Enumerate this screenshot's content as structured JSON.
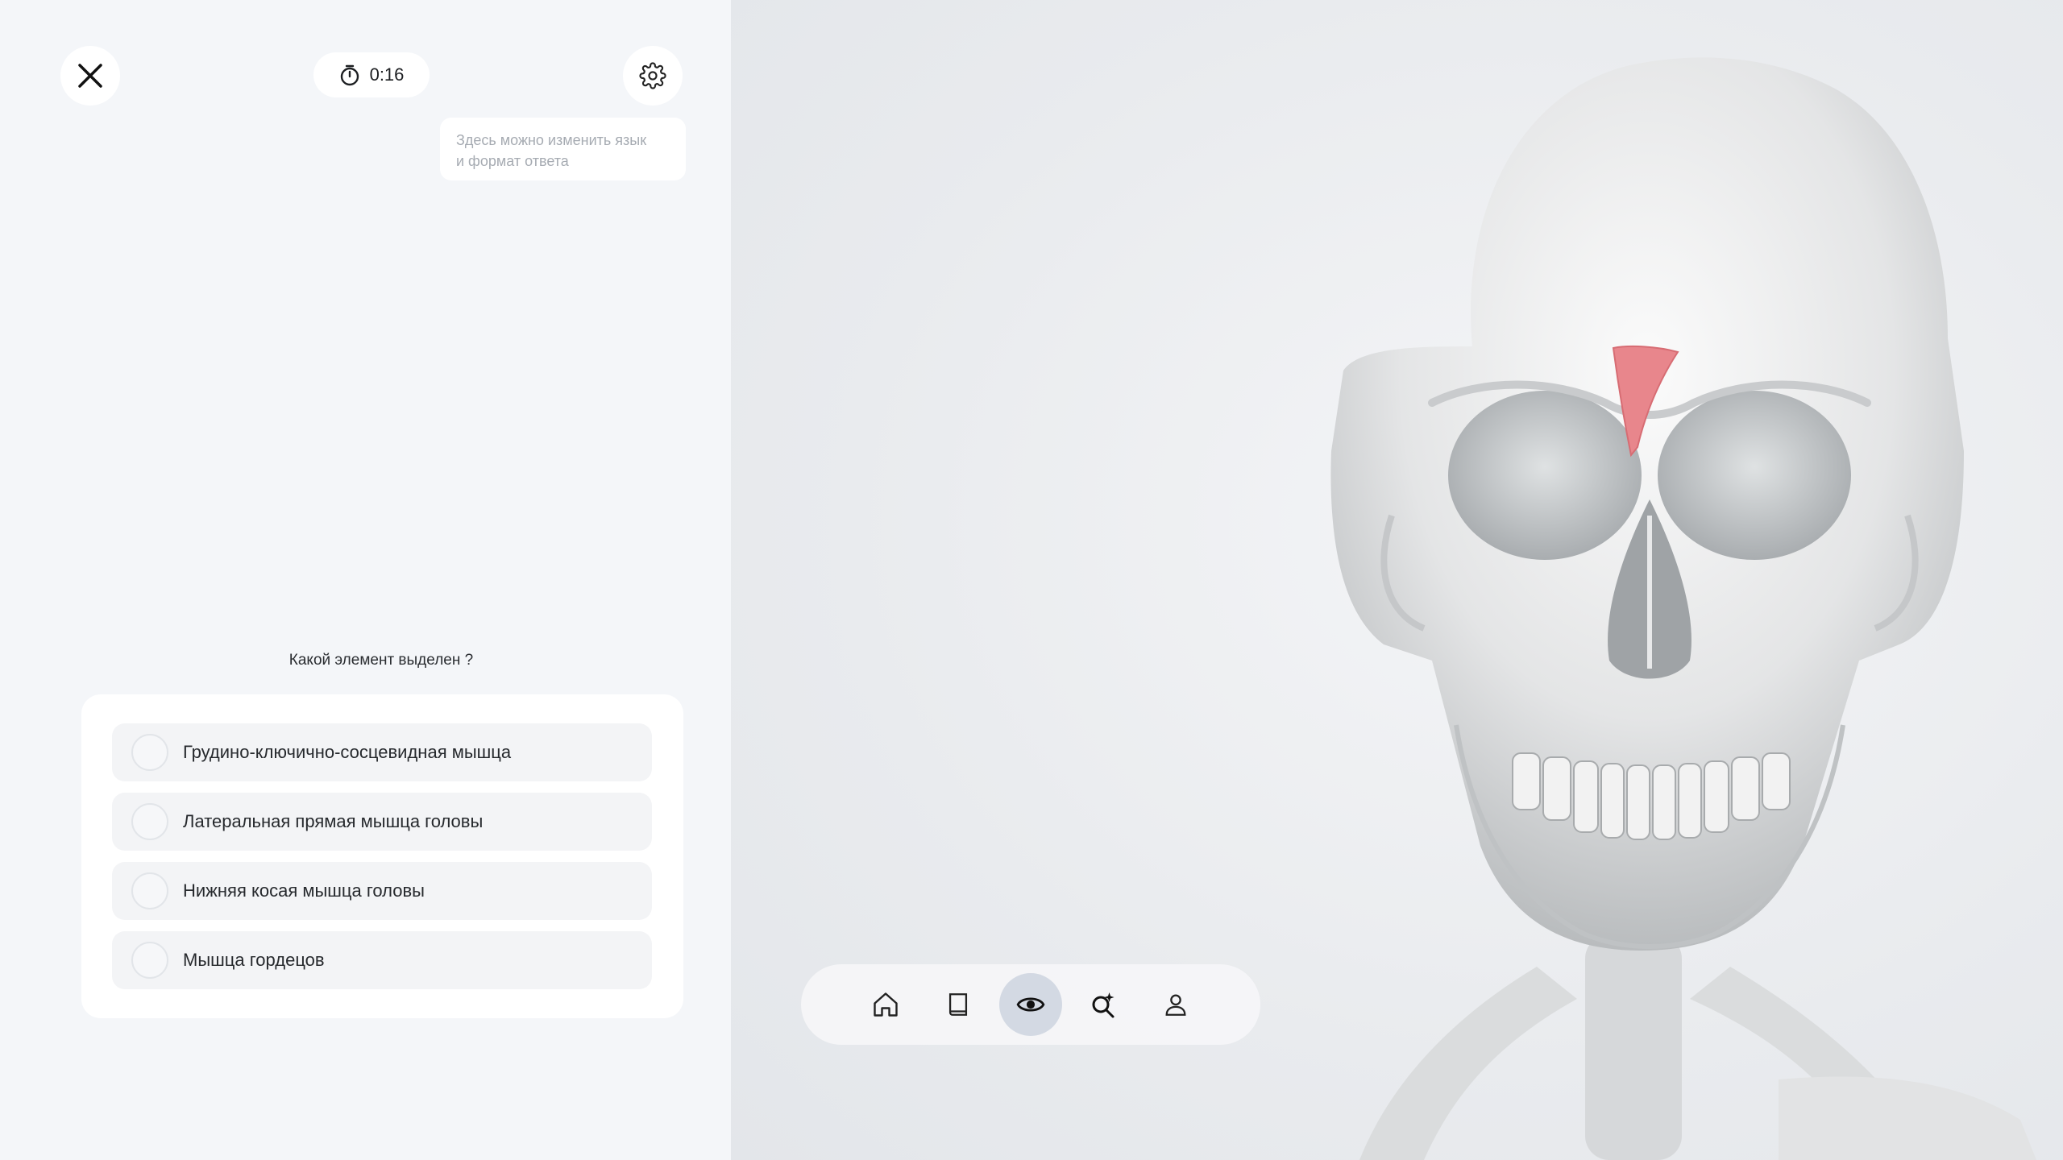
{
  "header": {
    "timer": "0:16",
    "tooltip_line1": "Здесь можно изменить язык",
    "tooltip_line2": "и формат ответа"
  },
  "quiz": {
    "question": "Какой элемент выделен ?",
    "answers": [
      {
        "label": "Грудино-ключично-сосцевидная мышца"
      },
      {
        "label": "Латеральная прямая мышца головы"
      },
      {
        "label": "Нижняя косая мышца головы"
      },
      {
        "label": "Мышца гордецов"
      }
    ]
  },
  "toolbar": {
    "items": [
      "home-icon",
      "book-icon",
      "eye-icon",
      "magic-search-icon",
      "user-icon"
    ],
    "active": "eye-icon"
  },
  "colors": {
    "highlight": "#e8868c",
    "active_tool": "#d3d9e3",
    "panel": "#f4f6f9"
  }
}
